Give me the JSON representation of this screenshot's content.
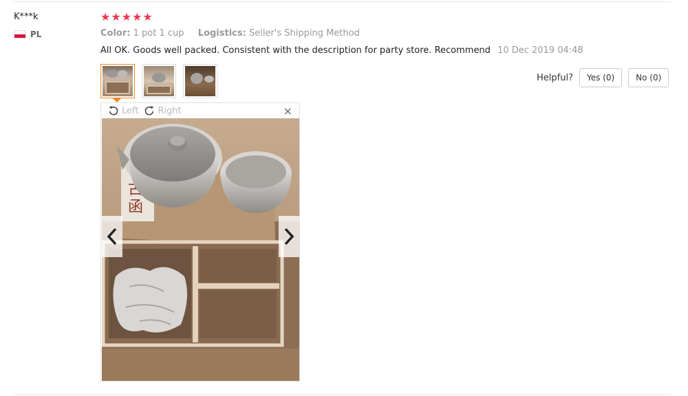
{
  "review": {
    "user_name": "K***k",
    "country": "PL",
    "rating": 5,
    "color_label": "Color:",
    "color_value": "1 pot 1 cup",
    "logistics_label": "Logistics:",
    "logistics_value": "Seller's Shipping Method",
    "text": "All OK. Goods well packed. Consistent with the description for party store. Recommend",
    "date": "10 Dec 2019 04:48"
  },
  "thumbnails": [
    "photo-1",
    "photo-2",
    "photo-3"
  ],
  "helpful": {
    "label": "Helpful?",
    "yes_label": "Yes (0)",
    "no_label": "No (0)"
  },
  "viewer": {
    "rotate_left_label": "Left",
    "rotate_right_label": "Right",
    "close_symbol": "×",
    "prev_icon": "chevron-left-icon",
    "next_icon": "chevron-right-icon"
  },
  "colors": {
    "star": "#f2374c",
    "active_thumb": "#f5841f",
    "muted_text": "#999999"
  }
}
